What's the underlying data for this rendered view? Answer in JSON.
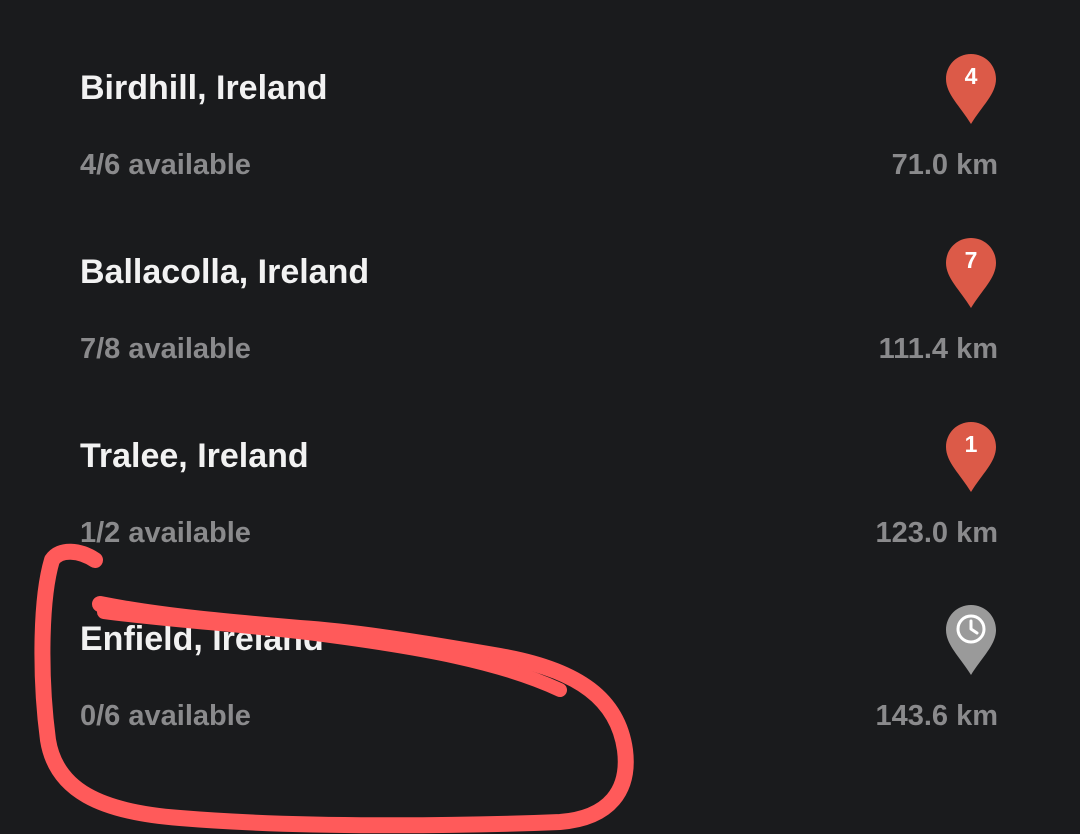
{
  "colors": {
    "background": "#1a1b1d",
    "name_text": "#f2f2f2",
    "secondary_text": "#8a8a8c",
    "pin_active": "#dc5a48",
    "pin_inactive": "#9a9a9a",
    "annotation_stroke": "#ff5a5a"
  },
  "locations": [
    {
      "name": "Birdhill, Ireland",
      "availability": "4/6 available",
      "distance": "71.0 km",
      "pin_label": "4",
      "pin_icon": "map-pin-icon"
    },
    {
      "name": "Ballacolla, Ireland",
      "availability": "7/8 available",
      "distance": "111.4 km",
      "pin_label": "7",
      "pin_icon": "map-pin-icon"
    },
    {
      "name": "Tralee, Ireland",
      "availability": "1/2 available",
      "distance": "123.0 km",
      "pin_label": "1",
      "pin_icon": "map-pin-icon"
    },
    {
      "name": "Enfield, Ireland",
      "availability": "0/6 available",
      "distance": "143.6 km",
      "pin_label": "",
      "pin_icon": "clock-pin-icon"
    }
  ]
}
